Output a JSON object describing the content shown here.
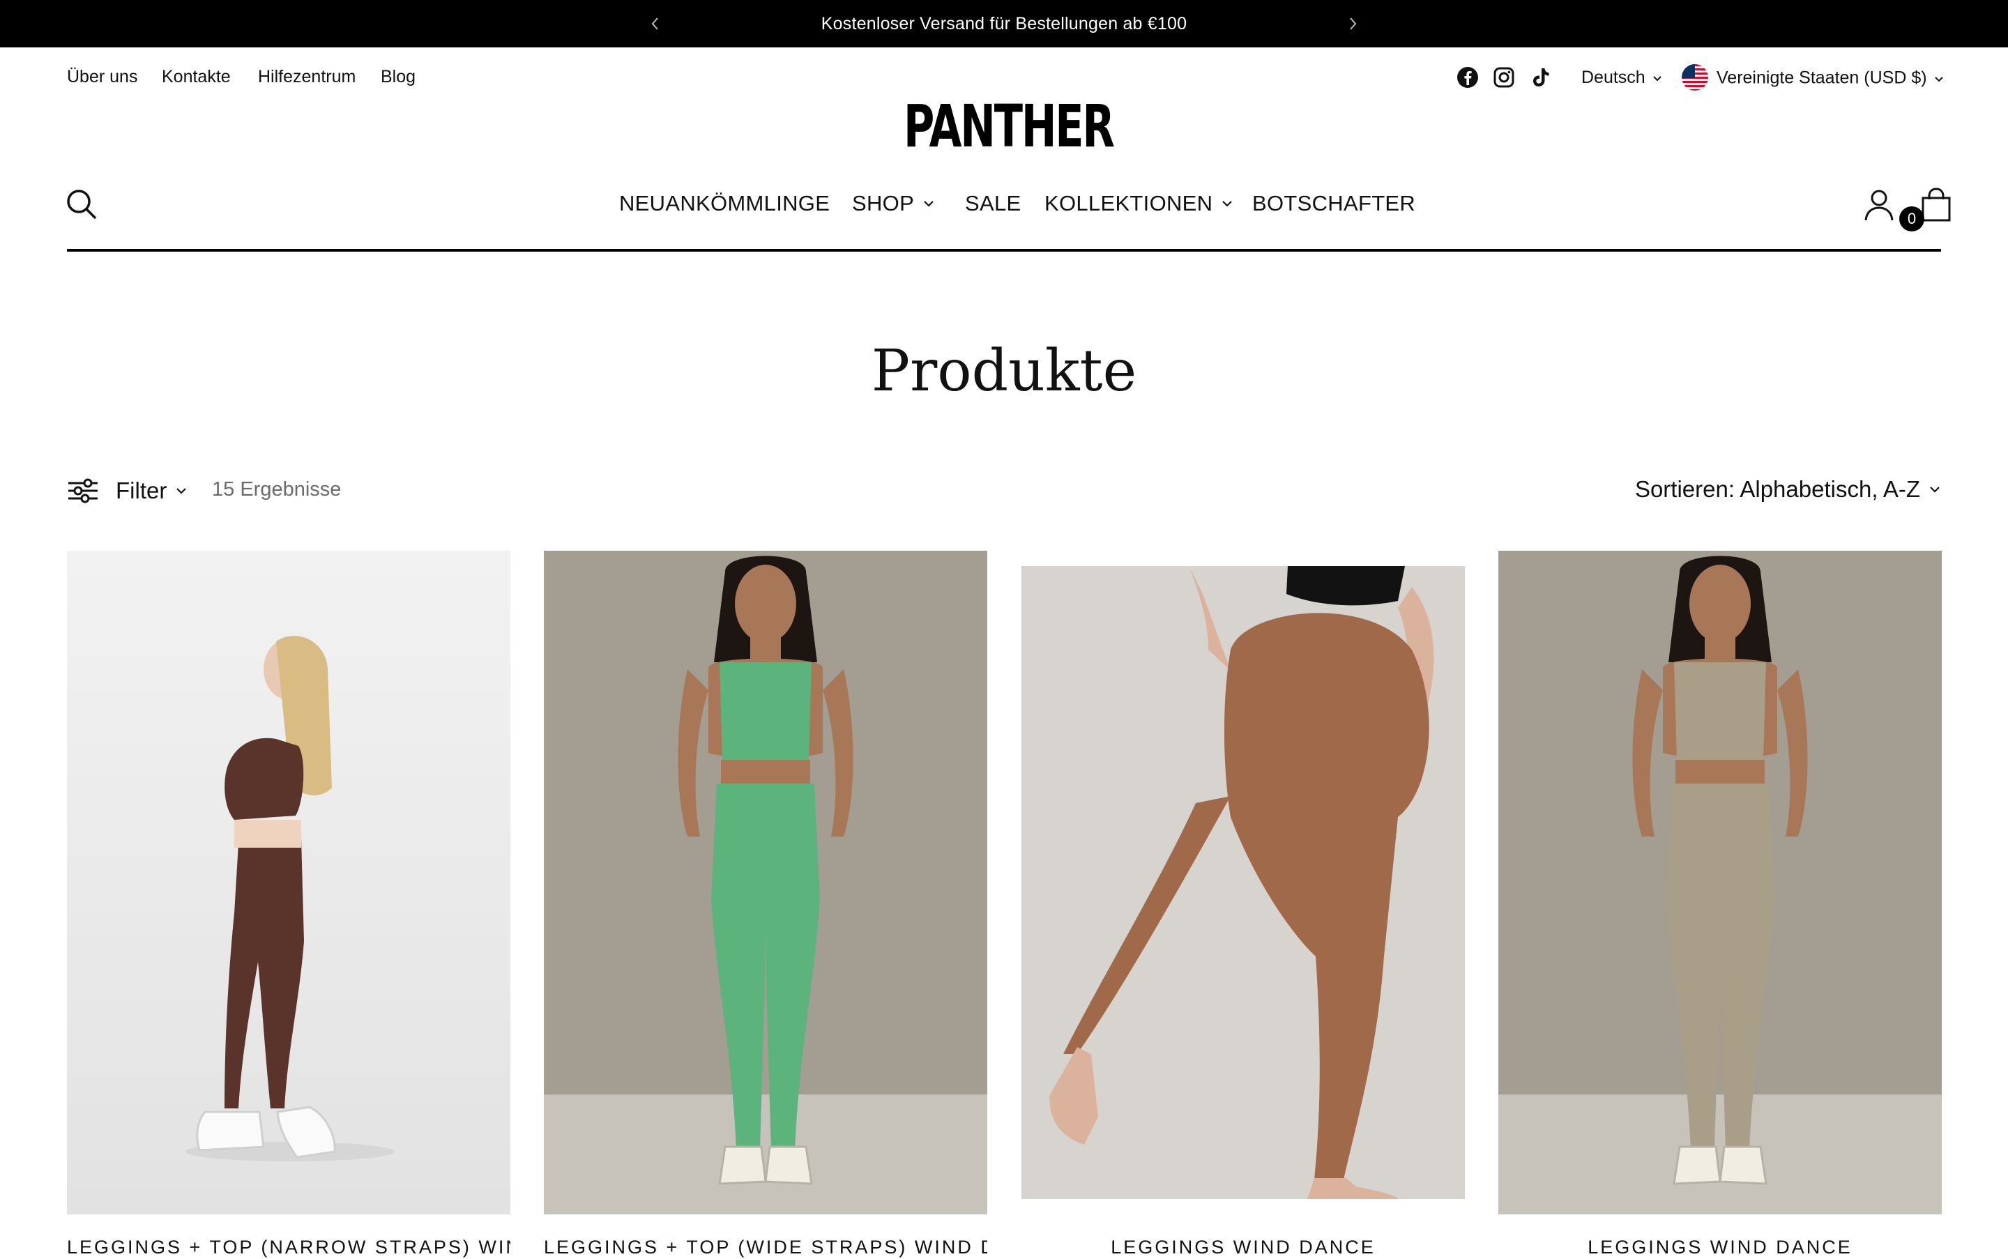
{
  "announcement": {
    "text": "Kostenloser Versand für Bestellungen ab €100",
    "prev_icon": "chevron-left-icon",
    "next_icon": "chevron-right-icon"
  },
  "utility_links": [
    "Über uns",
    "Kontakte",
    "Hilfezentrum",
    "Blog"
  ],
  "social_icons": [
    "facebook-icon",
    "instagram-icon",
    "tiktok-icon"
  ],
  "language": "Deutsch",
  "country": "Vereinigte Staaten (USD $)",
  "logo": "PANTHER",
  "nav": {
    "items": [
      {
        "label": "NEUANKÖMMLINGE",
        "has_dropdown": false
      },
      {
        "label": "SHOP",
        "has_dropdown": true
      },
      {
        "label": "SALE",
        "has_dropdown": false
      },
      {
        "label": "KOLLEKTIONEN",
        "has_dropdown": true
      },
      {
        "label": "BOTSCHAFTER",
        "has_dropdown": false
      }
    ],
    "cart_count": "0"
  },
  "page_title": "Produkte",
  "toolbar": {
    "filter_label": "Filter",
    "results": "15 Ergebnisse",
    "sort_label": "Sortieren: Alphabetisch, A-Z"
  },
  "products": [
    {
      "title": "LEGGINGS + TOP (NARROW STRAPS) WIND DANCE",
      "color": "#5a342a",
      "bg": "#ececec"
    },
    {
      "title": "LEGGINGS + TOP (WIDE STRAPS) WIND DANCE",
      "color": "#5cb47c",
      "bg": "#a39e91"
    },
    {
      "title": "LEGGINGS WIND DANCE",
      "color": "#a06a4a",
      "bg": "#d7d4cf"
    },
    {
      "title": "LEGGINGS WIND DANCE",
      "color": "#a99f88",
      "bg": "#a39e91"
    }
  ],
  "colors": {
    "black": "#000000",
    "text": "#111111",
    "muted": "#6b6b6b"
  }
}
